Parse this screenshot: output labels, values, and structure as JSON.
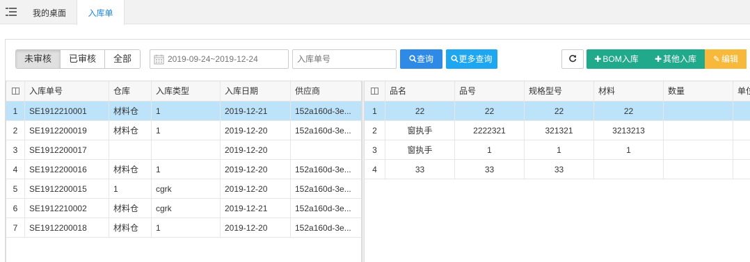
{
  "tabs": {
    "home": "我的桌面",
    "active": "入库单"
  },
  "filter": {
    "status_buttons": [
      "未审核",
      "已审核",
      "全部"
    ],
    "date_range_placeholder": "2019-09-24~2019-12-24",
    "order_no_placeholder": "入库单号"
  },
  "toolbar": {
    "query": "查询",
    "more_query": "更多查询",
    "bom_in": "BOM入库",
    "other_in": "其他入库",
    "edit": "编辑"
  },
  "left_grid": {
    "headers": [
      "入库单号",
      "仓库",
      "入库类型",
      "入库日期",
      "供应商"
    ],
    "rows": [
      {
        "n": "1",
        "no": "SE1912210001",
        "wh": "材料仓",
        "type": "1",
        "date": "2019-12-21",
        "supplier": "152a160d-3e..."
      },
      {
        "n": "2",
        "no": "SE1912200019",
        "wh": "材料仓",
        "type": "1",
        "date": "2019-12-20",
        "supplier": "152a160d-3e..."
      },
      {
        "n": "3",
        "no": "SE1912200017",
        "wh": "",
        "type": "",
        "date": "2019-12-20",
        "supplier": ""
      },
      {
        "n": "4",
        "no": "SE1912200016",
        "wh": "材料仓",
        "type": "1",
        "date": "2019-12-20",
        "supplier": "152a160d-3e..."
      },
      {
        "n": "5",
        "no": "SE1912200015",
        "wh": "1",
        "type": "cgrk",
        "date": "2019-12-20",
        "supplier": "152a160d-3e..."
      },
      {
        "n": "6",
        "no": "SE1912210002",
        "wh": "材料仓",
        "type": "cgrk",
        "date": "2019-12-21",
        "supplier": "152a160d-3e..."
      },
      {
        "n": "7",
        "no": "SE1912200018",
        "wh": "材料仓",
        "type": "1",
        "date": "2019-12-20",
        "supplier": "152a160d-3e..."
      }
    ]
  },
  "right_grid": {
    "headers": [
      "品名",
      "品号",
      "规格型号",
      "材料",
      "数量",
      "单位"
    ],
    "rows": [
      {
        "n": "1",
        "name": "22",
        "code": "22",
        "spec": "22",
        "material": "22",
        "qty": "",
        "unit": ""
      },
      {
        "n": "2",
        "name": "窗执手",
        "code": "2222321",
        "spec": "321321",
        "material": "3213213",
        "qty": "",
        "unit": ""
      },
      {
        "n": "3",
        "name": "窗执手",
        "code": "1",
        "spec": "1",
        "material": "1",
        "qty": "",
        "unit": ""
      },
      {
        "n": "4",
        "name": "33",
        "code": "33",
        "spec": "33",
        "material": "",
        "qty": "",
        "unit": ""
      }
    ]
  },
  "colors": {
    "primary": "#2f8ae5",
    "info": "#1ea7f0",
    "success": "#20a98b",
    "warning": "#f6b93b",
    "selected_row": "#bde3fb"
  }
}
